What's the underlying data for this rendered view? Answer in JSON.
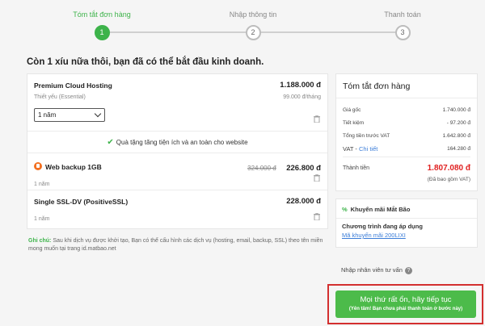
{
  "stepper": {
    "steps": [
      {
        "label": "Tóm tắt đơn hàng",
        "number": "1"
      },
      {
        "label": "Nhập thông tin",
        "number": "2"
      },
      {
        "label": "Thanh toán",
        "number": "3"
      }
    ],
    "active_step": 1
  },
  "headline": "Còn 1 xíu nữa thôi, bạn đã có thể bắt đầu kinh doanh.",
  "cart": {
    "items": [
      {
        "title": "Premium Cloud Hosting",
        "price": "1.188.000 đ",
        "subtitle": "Thiết yếu (Essential)",
        "unit_price": "99.000 đ/tháng",
        "term_selected": "1 năm"
      },
      {
        "title": "Web backup 1GB",
        "old_price": "324.000 đ",
        "price": "226.800 đ",
        "term": "1 năm"
      },
      {
        "title": "Single SSL-DV (PositiveSSL)",
        "price": "228.000 đ",
        "term": "1 năm"
      }
    ],
    "gift_text": "Quà tặng tăng tiện ích và an toàn cho website"
  },
  "note": {
    "label": "Ghi chú:",
    "text": " Sau khi dịch vụ được khởi tạo, Bạn có thể cấu hình các dịch vụ (hosting, email, backup, SSL) theo tên miền mong muốn tại trang id.matbao.net"
  },
  "summary": {
    "title": "Tóm tắt đơn hàng",
    "rows": [
      {
        "label": "Giá gốc",
        "value": "1.740.000 đ"
      },
      {
        "label": "Tiết kiệm",
        "value": "- 97.200 đ"
      },
      {
        "label": "Tổng tiền trước VAT",
        "value": "1.642.800 đ"
      }
    ],
    "vat_label": "VAT - ",
    "vat_link": "Chi tiết",
    "vat_value": "164.280 đ",
    "total_label": "Thành tiền",
    "total_value": "1.807.080 đ",
    "total_note": "(Đã bao gồm VAT)"
  },
  "promo": {
    "header": "Khuyến mãi Mắt Bão",
    "title": "Chương trình đang áp dụng",
    "link": "Mã khuyến mãi 200LIXI"
  },
  "staff": {
    "label": "Nhập nhân viên tư vấn",
    "help": "?"
  },
  "cta": {
    "main": "Mọi thứ rất ổn, hãy tiếp tục",
    "sub": "(Yên tâm! Bạn chưa phải thanh toán ở bước này)"
  },
  "colors": {
    "accent": "#3db34a",
    "total": "#e02020",
    "link": "#3b7dd8",
    "highlight_frame": "#d32f2f"
  }
}
